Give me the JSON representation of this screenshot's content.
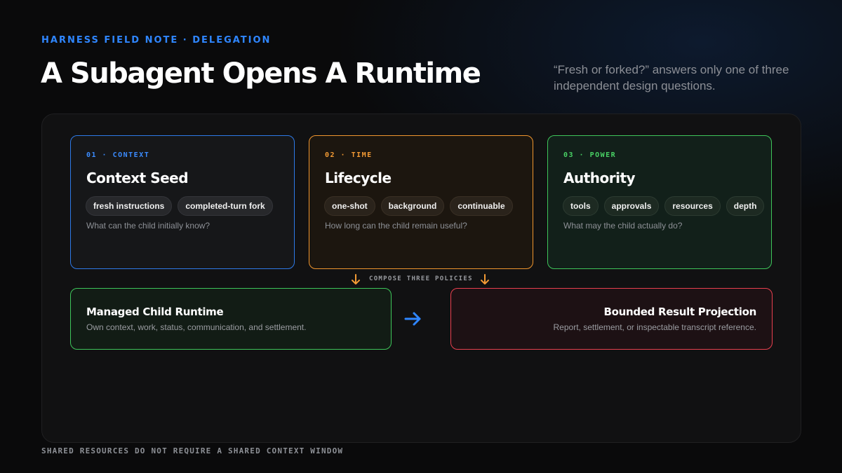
{
  "header": {
    "eyebrow": "HARNESS FIELD NOTE · DELEGATION",
    "title": "A Subagent Opens A Runtime",
    "subtitle": "“Fresh or forked?” answers only one of three independent design questions."
  },
  "cards": [
    {
      "kicker": "01 · CONTEXT",
      "title": "Context Seed",
      "tags": [
        "fresh instructions",
        "completed-turn fork"
      ],
      "question": "What can the child initially know?",
      "color": "#2e7ae8"
    },
    {
      "kicker": "02 · TIME",
      "title": "Lifecycle",
      "tags": [
        "one-shot",
        "background",
        "continuable"
      ],
      "question": "How long can the child remain useful?",
      "color": "#f0962e"
    },
    {
      "kicker": "03 · POWER",
      "title": "Authority",
      "tags": [
        "tools",
        "approvals",
        "resources",
        "depth"
      ],
      "question": "What may the child actually do?",
      "color": "#3ec55a"
    }
  ],
  "compose_label": "COMPOSE THREE POLICIES",
  "runtime": {
    "title": "Managed Child Runtime",
    "description": "Own context, work, status, communication, and settlement.",
    "color": "#3ec55a"
  },
  "result": {
    "title": "Bounded Result Projection",
    "description": "Report, settlement, or inspectable transcript reference.",
    "color": "#e8404f"
  },
  "footer": "SHARED RESOURCES DO NOT REQUIRE A SHARED CONTEXT WINDOW",
  "colors": {
    "accent_blue": "#2f86ff",
    "arrow_orange": "#f29a34",
    "flow_arrow": "#2f86ff"
  }
}
